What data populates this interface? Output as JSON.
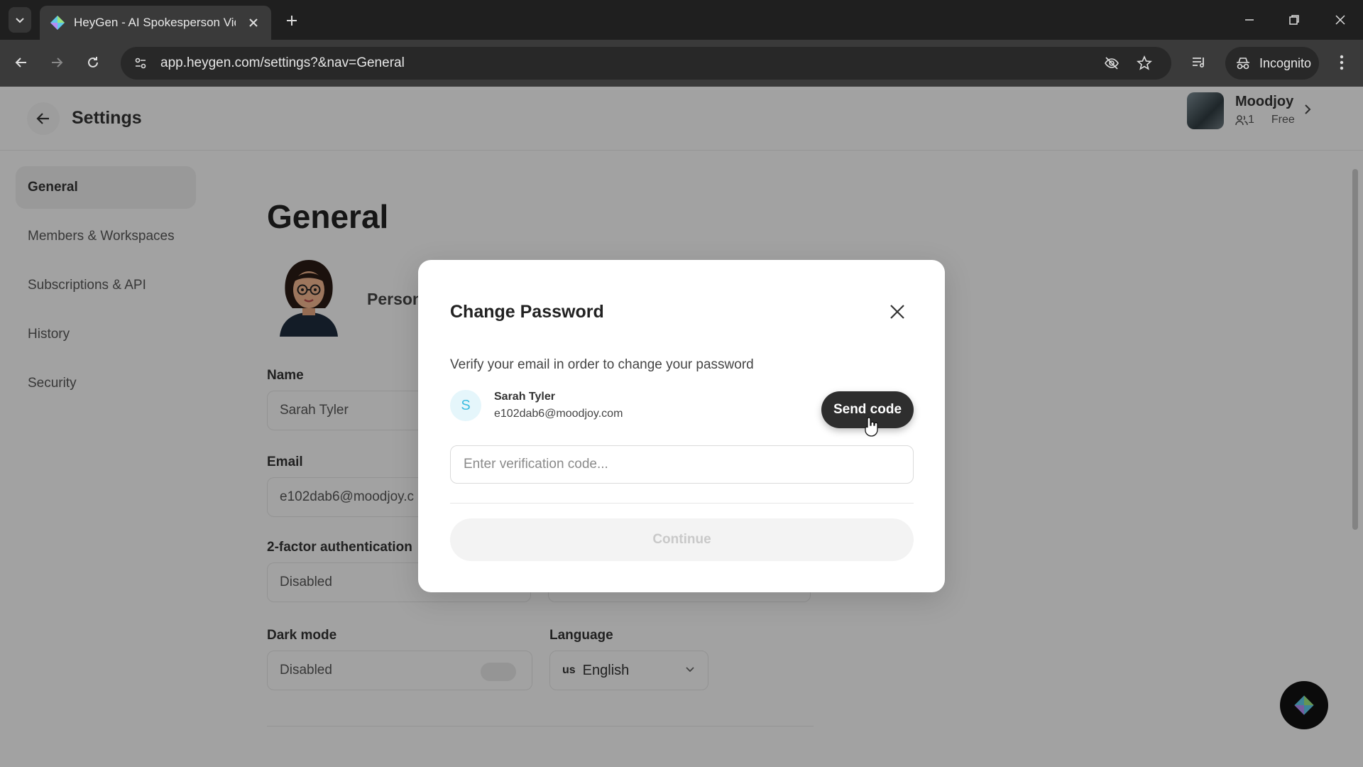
{
  "browser": {
    "tab_title": "HeyGen - AI Spokesperson Vid",
    "url": "app.heygen.com/settings?&nav=General",
    "incognito_label": "Incognito"
  },
  "header": {
    "title": "Settings",
    "workspace": {
      "name": "Moodjoy",
      "members": "1",
      "plan": "Free"
    }
  },
  "sidebar": {
    "items": [
      {
        "label": "General",
        "active": true
      },
      {
        "label": "Members & Workspaces",
        "active": false
      },
      {
        "label": "Subscriptions & API",
        "active": false
      },
      {
        "label": "History",
        "active": false
      },
      {
        "label": "Security",
        "active": false
      }
    ]
  },
  "main": {
    "title": "General",
    "personal_label": "Person",
    "name_label": "Name",
    "name_value": "Sarah Tyler",
    "email_label": "Email",
    "email_value": "e102dab6@moodjoy.c",
    "twofa_label": "2-factor authentication",
    "twofa_value": "Disabled",
    "darkmode_label": "Dark mode",
    "darkmode_value": "Disabled",
    "language_label": "Language",
    "language_flag": "us",
    "language_value": "English"
  },
  "modal": {
    "title": "Change Password",
    "description": "Verify your email in order to change your password",
    "user_initial": "S",
    "user_name": "Sarah Tyler",
    "user_email": "e102dab6@moodjoy.com",
    "send_code_label": "Send code",
    "code_placeholder": "Enter verification code...",
    "continue_label": "Continue"
  },
  "colors": {
    "primary_button": "#2e2e2e",
    "overlay": "rgba(0,0,0,0.34)",
    "avatar_accent": "#3cbde0"
  }
}
